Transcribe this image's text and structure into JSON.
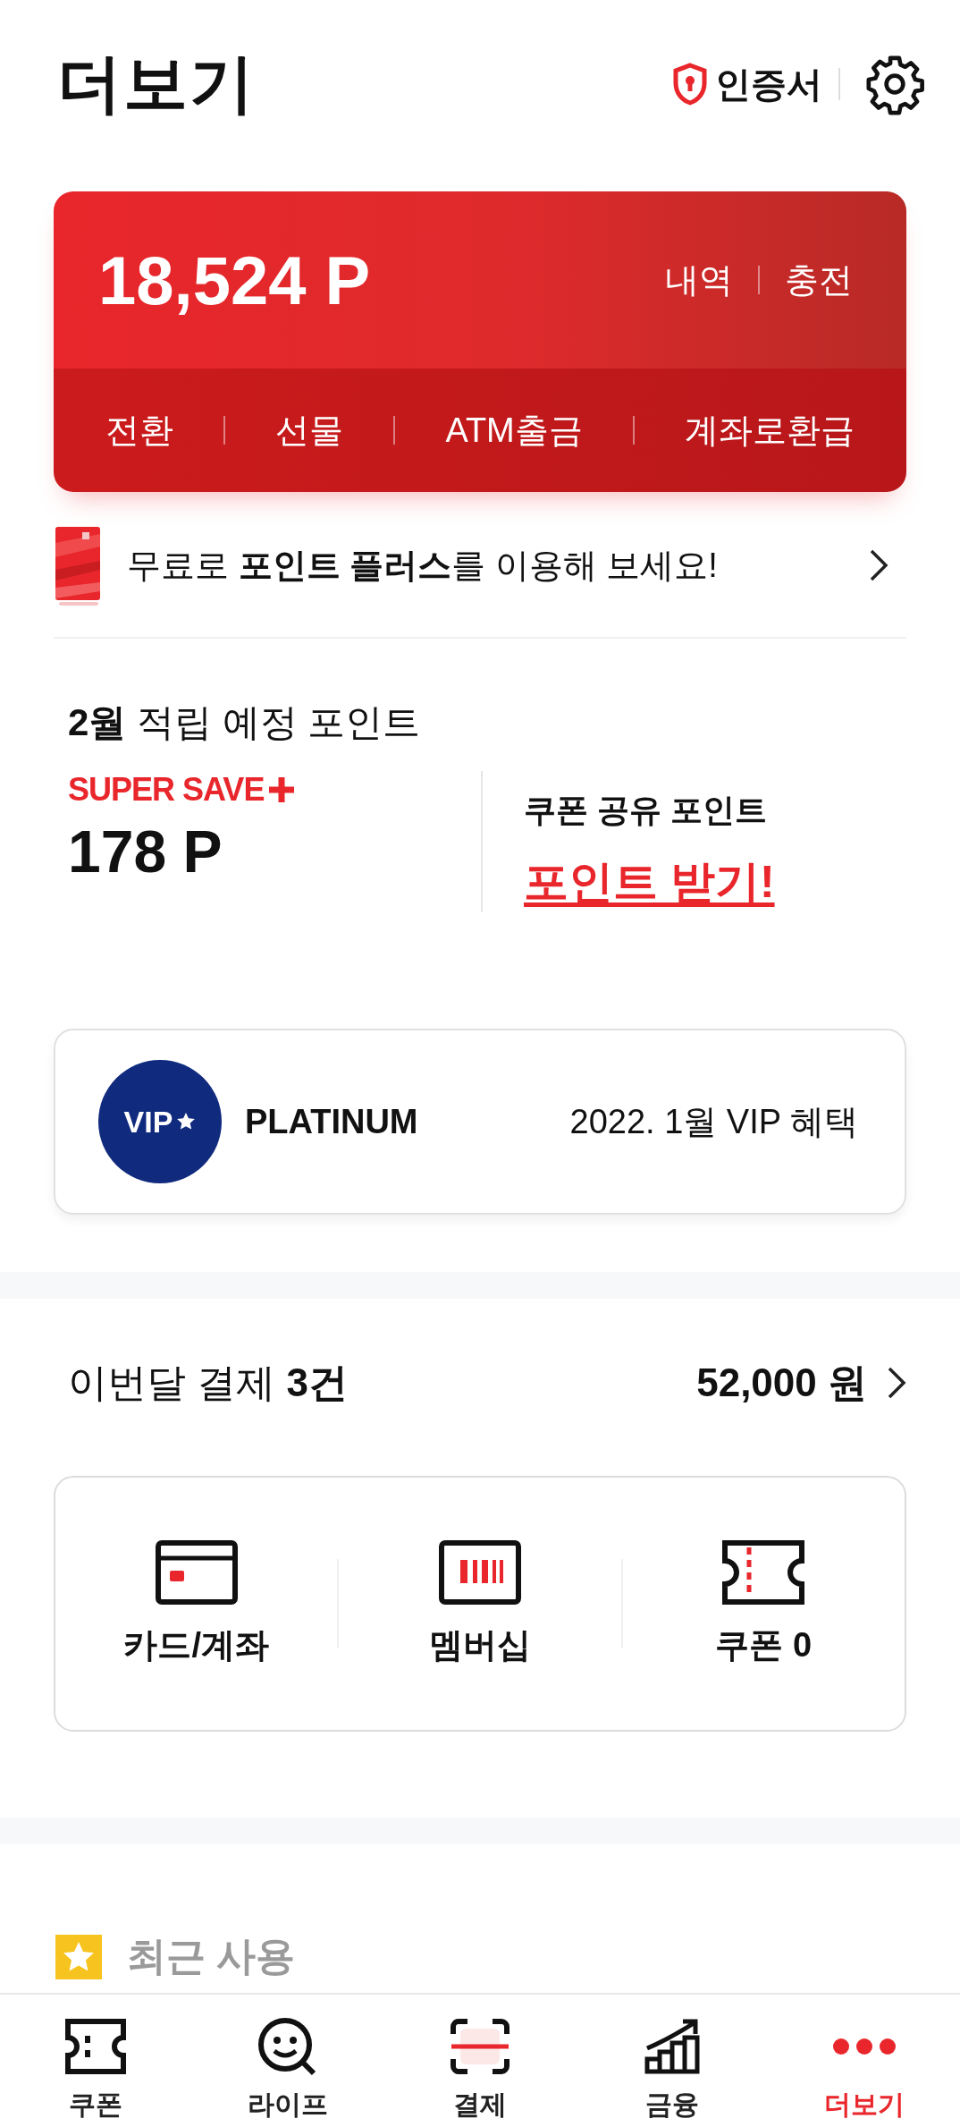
{
  "header": {
    "title": "더보기",
    "certificate": "인증서"
  },
  "points": {
    "balance": "18,524 P",
    "links": [
      "내역",
      "충전"
    ],
    "actions": [
      "전환",
      "선물",
      "ATM출금",
      "계좌로환급"
    ]
  },
  "promo": {
    "text": "무료로 **포인트 플러스**를 이용해 보세요!"
  },
  "expected": {
    "title": "**2월** 적립 예정 포인트",
    "super_save": {
      "label": "SUPER SAVE",
      "amount": "178 P"
    },
    "coupon_share": {
      "label": "쿠폰 공유 포인트",
      "link": "포인트 받기!"
    }
  },
  "vip": {
    "badge": "VIP",
    "grade": "PLATINUM",
    "benefit": "2022. 1월 VIP 혜택"
  },
  "payments": {
    "summary": "이번달 결제 **3건**",
    "amount": "52,000 원"
  },
  "shortcuts": [
    {
      "kind": "card",
      "label": "카드/계좌"
    },
    {
      "kind": "membership",
      "label": "멤버십"
    },
    {
      "kind": "coupon",
      "label": "쿠폰 0"
    }
  ],
  "recent": {
    "title": "최근 사용"
  },
  "tab_bar": [
    {
      "kind": "coupon",
      "label": "쿠폰",
      "selected": false
    },
    {
      "kind": "life",
      "label": "라이프",
      "selected": false
    },
    {
      "kind": "pay",
      "label": "결제",
      "selected": false
    },
    {
      "kind": "finance",
      "label": "금융",
      "selected": false
    },
    {
      "kind": "more",
      "label": "더보기",
      "selected": true
    }
  ]
}
